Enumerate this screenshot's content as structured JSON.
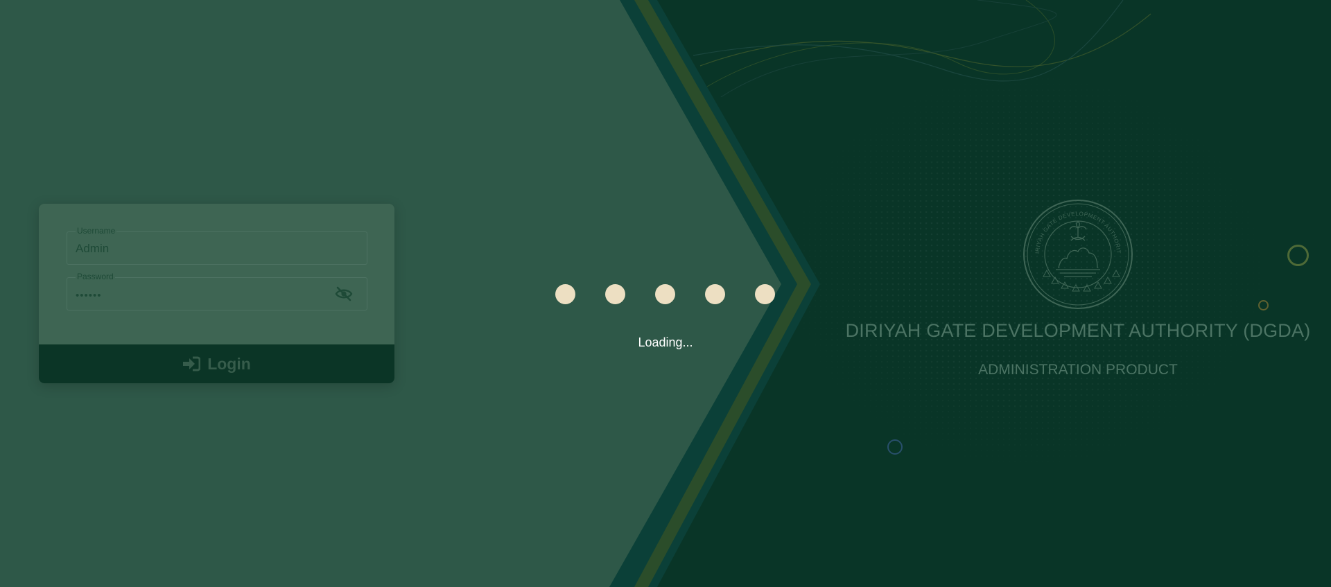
{
  "login": {
    "username_label": "Username",
    "username_value": "Admin",
    "password_label": "Password",
    "password_value": "••••••",
    "login_label": "Login"
  },
  "loading": {
    "text": "Loading..."
  },
  "branding": {
    "title": "DIRIYAH GATE DEVELOPMENT AUTHORITY (DGDA)",
    "subtitle": "ADMINISTRATION PRODUCT",
    "seal_ring_text": "DIRIYAH GATE DEVELOPMENT AUTHORITY"
  },
  "colors": {
    "left_panel": "#2e5848",
    "right_panel": "#093527",
    "chevron_teal": "#0b4038",
    "chevron_olive": "#2b4d2a",
    "dots": "#eddfc2",
    "login_button": "#0b3526"
  },
  "icons": {
    "login": "sign-in-icon",
    "password_toggle": "eye-slash-icon",
    "seal": "dgda-seal-logo"
  }
}
